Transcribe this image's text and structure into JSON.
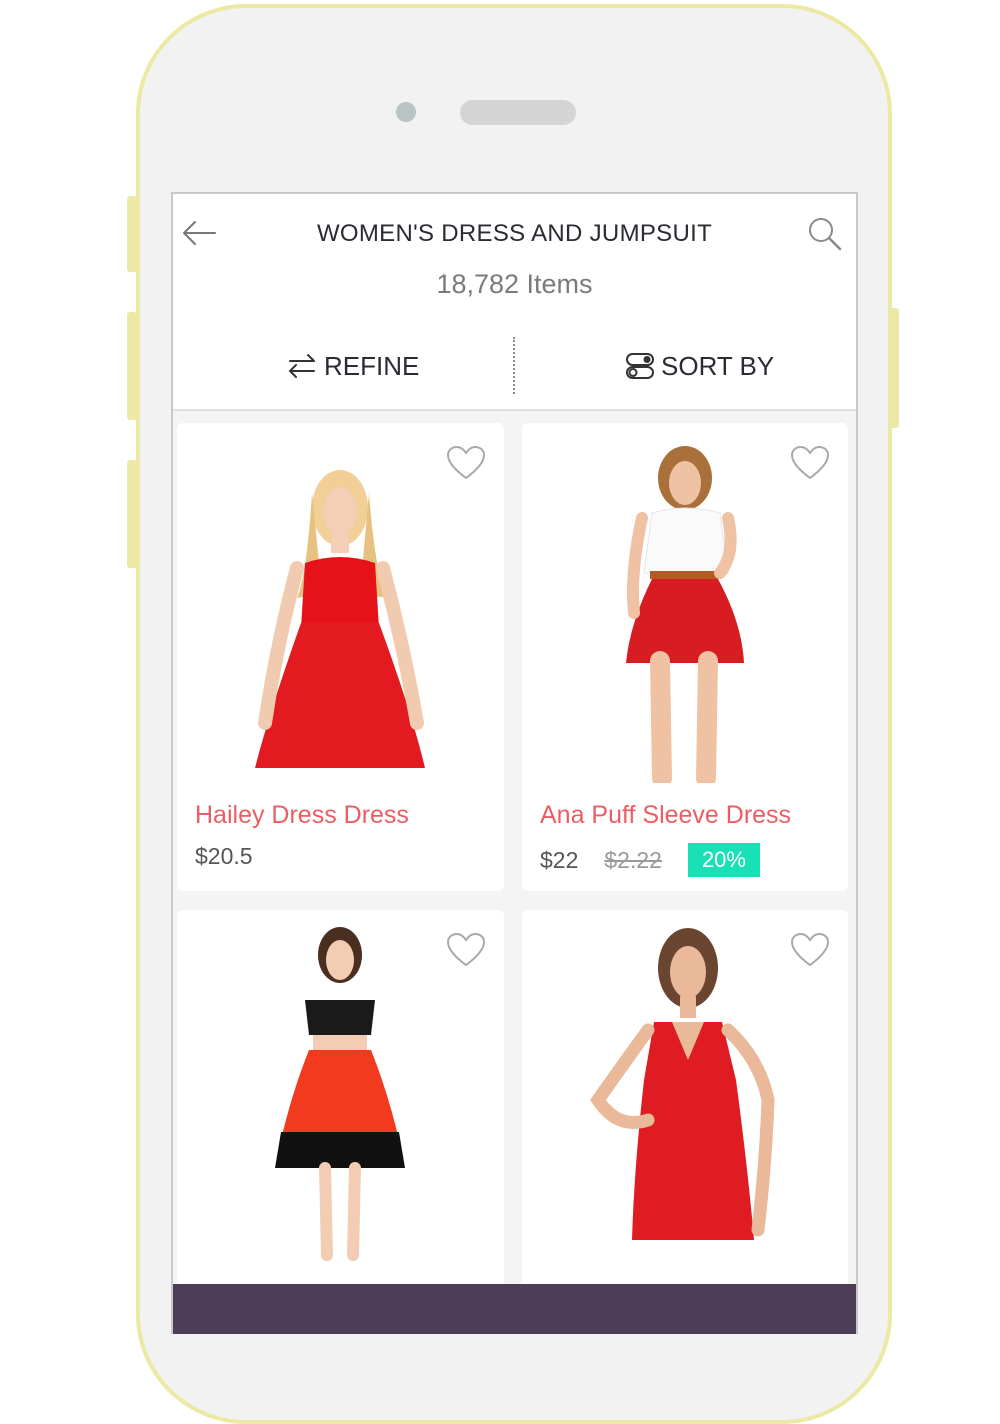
{
  "header": {
    "title": "WOMEN'S DRESS AND JUMPSUIT",
    "item_count": "18,782 Items",
    "back_icon": "arrow-left-icon",
    "search_icon": "search-icon"
  },
  "toolbar": {
    "refine_label": "REFINE",
    "refine_icon": "swap-arrows-icon",
    "sort_label": "SORT BY",
    "sort_icon": "toggle-icon"
  },
  "products": [
    {
      "name": "Hailey Dress Dress",
      "price": "$20.5",
      "image": "red-strapless-dress-image"
    },
    {
      "name": "Ana Puff Sleeve Dress",
      "price": "$22",
      "old_price": "$2.22",
      "discount": "20%",
      "image": "red-skirt-white-top-image"
    },
    {
      "image": "black-top-red-skirt-image"
    },
    {
      "image": "red-halter-dress-image"
    }
  ],
  "colors": {
    "accent": "#ec5d63",
    "discount": "#19e0b6",
    "bottom_bar": "#4d3d58",
    "phone_frame": "#ece9a4"
  }
}
